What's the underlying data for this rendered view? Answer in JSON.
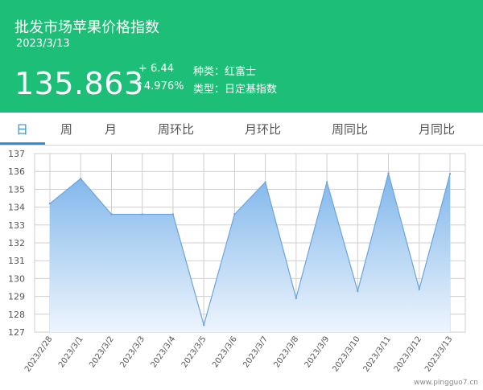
{
  "header": {
    "title": "批发市场苹果价格指数",
    "date": "2023/3/13",
    "price": "135.863",
    "change": "+ 6.44",
    "change_pct": "↑4.976%",
    "variety": "种类：红富士",
    "index_type": "类型：日定基指数"
  },
  "tabs": [
    {
      "label": "日"
    },
    {
      "label": "周"
    },
    {
      "label": "月"
    },
    {
      "label": "周环比"
    },
    {
      "label": "月环比"
    },
    {
      "label": "周同比"
    },
    {
      "label": "月同比"
    }
  ],
  "active_tab": 0,
  "watermark": "www.pingguo7.cn",
  "colors": {
    "header_bg": "#1dbf78",
    "accent": "#2a90d8",
    "area_top": "#7fb6ea",
    "area_bottom": "#eef5fd",
    "line": "#6aa5e2",
    "grid": "#cfcfcf"
  },
  "chart_data": {
    "type": "area",
    "x": [
      "2023/2/28",
      "2023/3/1",
      "2023/3/2",
      "2023/3/3",
      "2023/3/4",
      "2023/3/5",
      "2023/3/6",
      "2023/3/7",
      "2023/3/8",
      "2023/3/9",
      "2023/3/10",
      "2023/3/11",
      "2023/3/12",
      "2023/3/13"
    ],
    "values": [
      134.2,
      135.6,
      133.6,
      133.6,
      133.6,
      127.4,
      133.6,
      135.4,
      128.9,
      135.4,
      129.3,
      135.9,
      129.4,
      135.863
    ],
    "yticks": [
      127,
      128,
      129,
      130,
      131,
      132,
      133,
      134,
      135,
      136,
      137
    ],
    "ylim": [
      127,
      137
    ],
    "grid": true
  }
}
